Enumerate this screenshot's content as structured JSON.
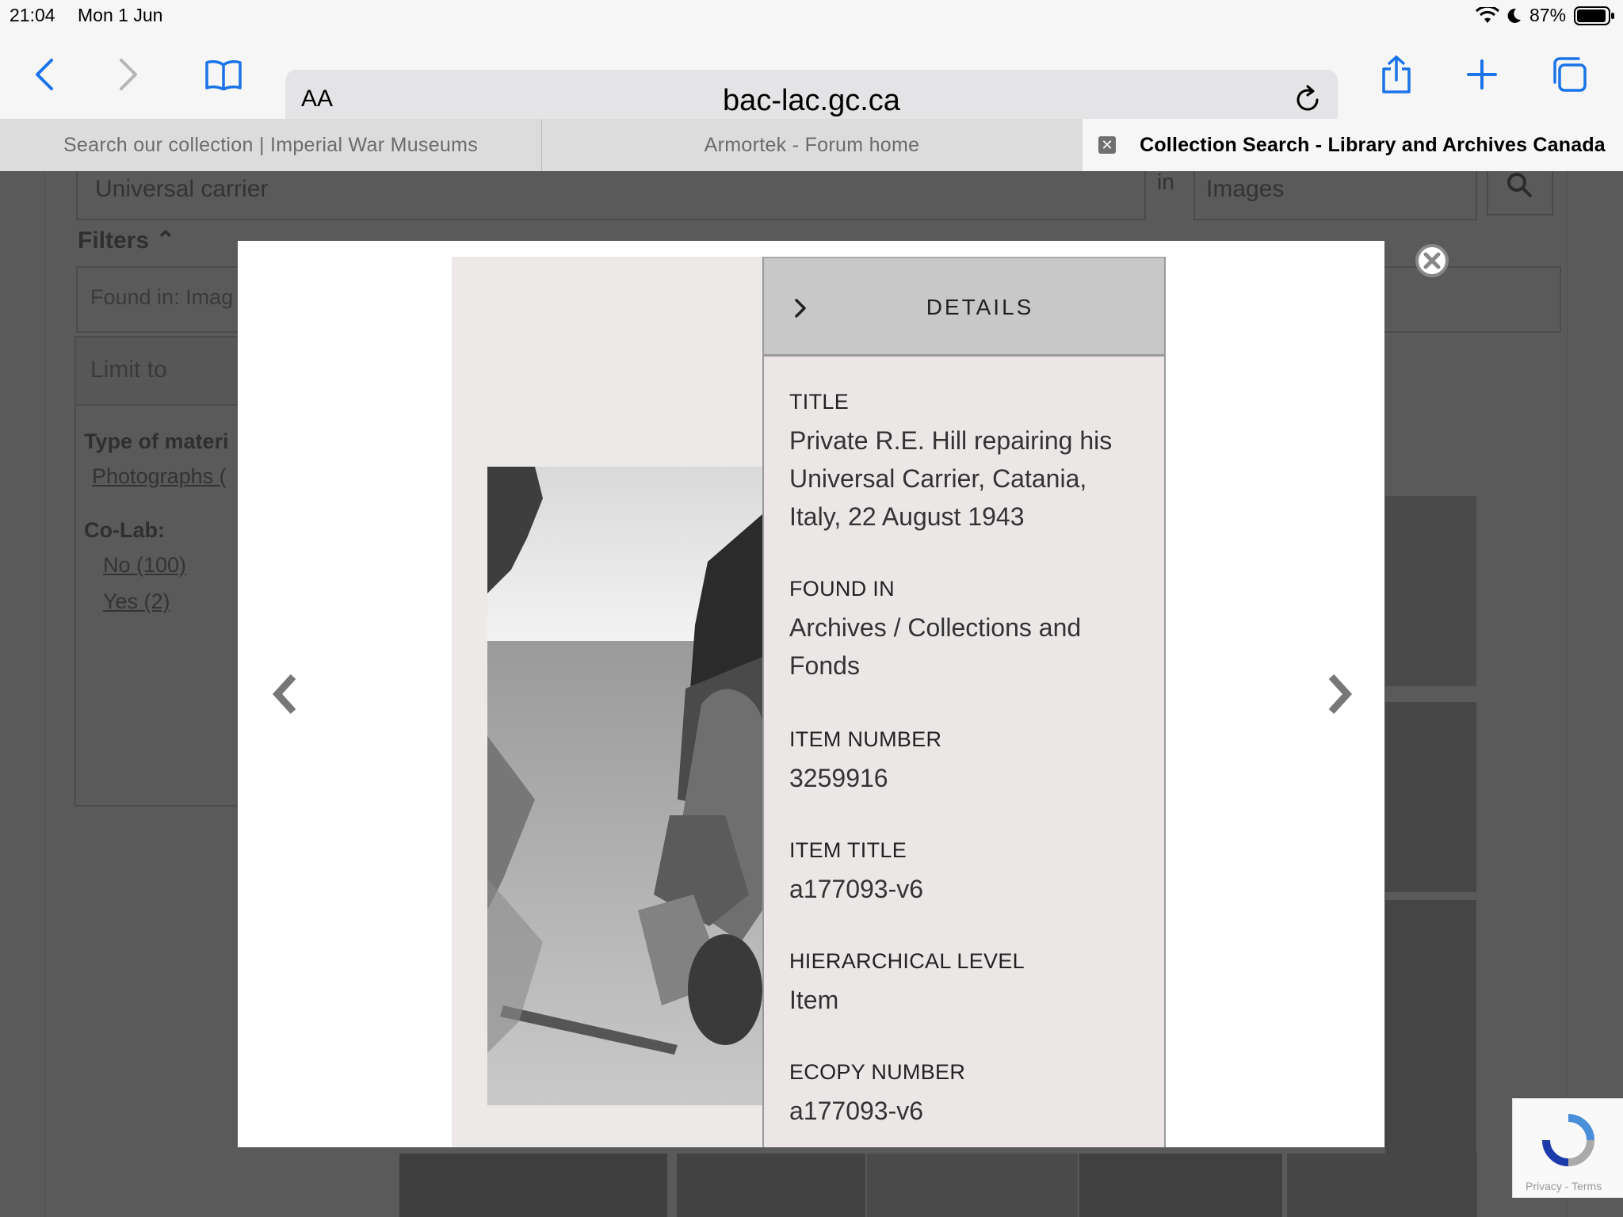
{
  "status_bar": {
    "time": "21:04",
    "date": "Mon 1 Jun",
    "battery": "87%"
  },
  "toolbar": {
    "text_size": "AA",
    "url": "bac-lac.gc.ca"
  },
  "tabs": [
    {
      "label": "Search our collection | Imperial War Museums"
    },
    {
      "label": "Armortek - Forum home"
    },
    {
      "label": "Collection Search - Library and Archives Canada"
    }
  ],
  "background_page": {
    "search_value": "Universal carrier",
    "in_label": "in",
    "scope_value": "Images",
    "filters_label": "Filters",
    "found_in": "Found in: Imag",
    "limit_to": "Limit to",
    "type_of_material": "Type of materi",
    "photographs_link": "Photographs (",
    "colab_label": "Co-Lab:",
    "colab_no": "No (100)",
    "colab_yes": "Yes (2)"
  },
  "details": {
    "header": "DETAILS",
    "fields": [
      {
        "label": "TITLE",
        "value": "Private R.E. Hill repairing his Universal Carrier, Catania, Italy, 22 August 1943"
      },
      {
        "label": "FOUND IN",
        "value": "Archives / Collections and Fonds"
      },
      {
        "label": "ITEM NUMBER",
        "value": "3259916"
      },
      {
        "label": "ITEM TITLE",
        "value": "a177093-v6"
      },
      {
        "label": "HIERARCHICAL LEVEL",
        "value": "Item"
      },
      {
        "label": "ECOPY NUMBER",
        "value": "a177093-v6"
      }
    ]
  },
  "recaptcha": {
    "text": "Privacy - Terms"
  },
  "icons": [
    "back-icon",
    "forward-icon",
    "bookmarks-icon",
    "reload-icon",
    "share-icon",
    "new-tab-icon",
    "tabs-overview-icon",
    "wifi-icon",
    "moon-icon",
    "battery-icon",
    "close-icon",
    "chevron-right-icon",
    "previous-arrow-icon",
    "next-arrow-icon"
  ]
}
